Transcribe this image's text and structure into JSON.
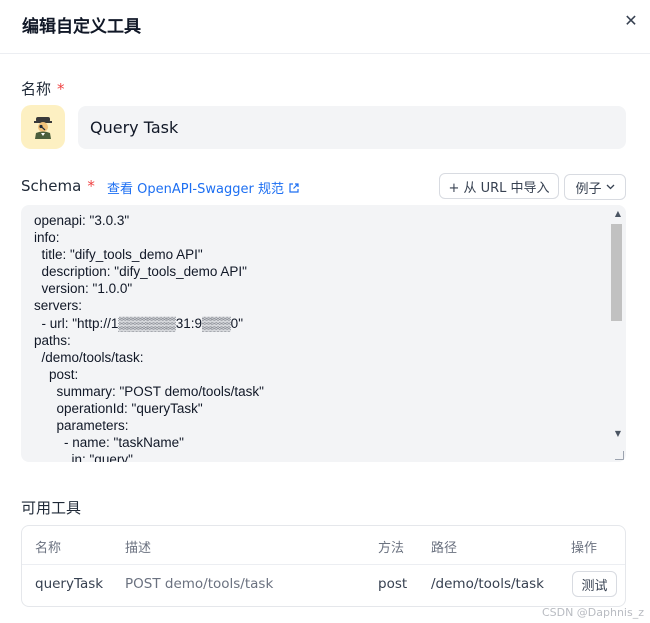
{
  "dialog": {
    "title": "编辑自定义工具",
    "close_icon": "close-icon"
  },
  "name_section": {
    "label": "名称",
    "required_mark": "*",
    "value": "Query Task",
    "avatar_icon": "emoji-avatar-icon"
  },
  "schema": {
    "label": "Schema",
    "required_mark": "*",
    "link_text": "查看 OpenAPI-Swagger 规范",
    "import_button": "+ 从 URL 中导入",
    "example_button": "例子",
    "code": "openapi: \"3.0.3\"\ninfo:\n  title: \"dify_tools_demo API\"\n  description: \"dify_tools_demo API\"\n  version: \"1.0.0\"\nservers:\n  - url: \"http://1▒▒▒▒▒▒31:9▒▒▒0\"\npaths:\n  /demo/tools/task:\n    post:\n      summary: \"POST demo/tools/task\"\n      operationId: \"queryTask\"\n      parameters:\n        - name: \"taskName\"\n          in: \"query\""
  },
  "tools": {
    "label": "可用工具",
    "headers": [
      "名称",
      "描述",
      "方法",
      "路径",
      "操作"
    ],
    "rows": [
      {
        "name": "queryTask",
        "description": "POST demo/tools/task",
        "method": "post",
        "path": "/demo/tools/task",
        "action": "测试"
      }
    ]
  },
  "watermark": "CSDN @Daphnis_z",
  "colors": {
    "accent": "#1d6ff2",
    "required": "#ef4444",
    "avatar_bg": "#fdf0c2"
  }
}
